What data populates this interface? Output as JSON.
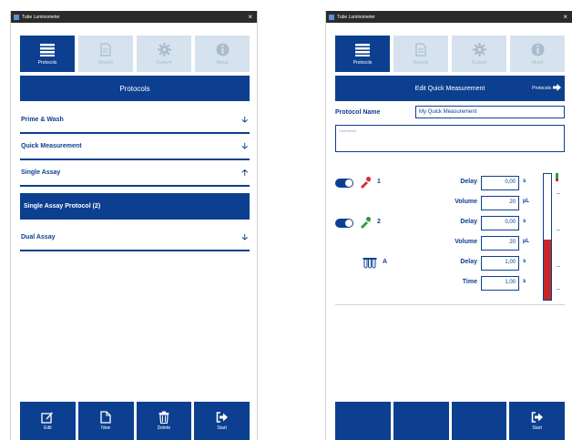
{
  "windows": {
    "left": {
      "title": "Tube Luminometer",
      "close_glyph": "×",
      "tabs": [
        {
          "label": "Protocols",
          "icon": "list-icon",
          "active": true
        },
        {
          "label": "Results",
          "icon": "document-icon",
          "active": false
        },
        {
          "label": "System",
          "icon": "gear-icon",
          "active": false
        },
        {
          "label": "About",
          "icon": "info-icon",
          "active": false
        }
      ],
      "header": "Protocols",
      "protocols": [
        {
          "label": "Prime & Wash",
          "arrow": "🡣"
        },
        {
          "label": "Quick Measurement",
          "arrow": "🡣"
        },
        {
          "label": "Single Assay",
          "arrow": "🡡"
        },
        {
          "label": "Dual Assay",
          "arrow": "🡣"
        }
      ],
      "selected_protocol": "Single Assay Protocol (2)",
      "bottom_buttons": [
        {
          "label": "Edit",
          "icon": "edit-icon"
        },
        {
          "label": "New",
          "icon": "new-file-icon"
        },
        {
          "label": "Delete",
          "icon": "trash-icon"
        },
        {
          "label": "Start",
          "icon": "start-icon"
        }
      ]
    },
    "right": {
      "title": "Tube Luminometer",
      "close_glyph": "×",
      "tabs": [
        {
          "label": "Protocols",
          "icon": "list-icon",
          "active": true
        },
        {
          "label": "Results",
          "icon": "document-icon",
          "active": false
        },
        {
          "label": "System",
          "icon": "gear-icon",
          "active": false
        },
        {
          "label": "About",
          "icon": "info-icon",
          "active": false
        }
      ],
      "header": "Edit Quick Measurement",
      "back_link": "Protocols",
      "protocol_name_label": "Protocol Name",
      "protocol_name_value": "My Quick Measurement",
      "comments_placeholder": "Comments",
      "injectors": [
        {
          "id": "1",
          "color": "#d32f2f",
          "enabled": true,
          "params": [
            {
              "label": "Delay",
              "value": "0,00",
              "unit": "s"
            },
            {
              "label": "Volume",
              "value": "20",
              "unit": "µL"
            }
          ]
        },
        {
          "id": "2",
          "color": "#2e9a3a",
          "enabled": true,
          "params": [
            {
              "label": "Delay",
              "value": "0,00",
              "unit": "s"
            },
            {
              "label": "Volume",
              "value": "20",
              "unit": "µL"
            }
          ]
        }
      ],
      "measurement": {
        "id": "A",
        "params": [
          {
            "label": "Delay",
            "value": "1,00",
            "unit": "s"
          },
          {
            "label": "Time",
            "value": "1,00",
            "unit": "s"
          }
        ]
      },
      "gauge_fill_fraction": 0.48,
      "bottom_buttons": [
        {
          "label": ""
        },
        {
          "label": ""
        },
        {
          "label": ""
        },
        {
          "label": "Start",
          "icon": "start-icon"
        }
      ]
    }
  },
  "colors": {
    "primary": "#0c3f8f",
    "tab_inactive": "#d6e3ee",
    "injector_red": "#d32f2f",
    "injector_green": "#2e9a3a"
  }
}
